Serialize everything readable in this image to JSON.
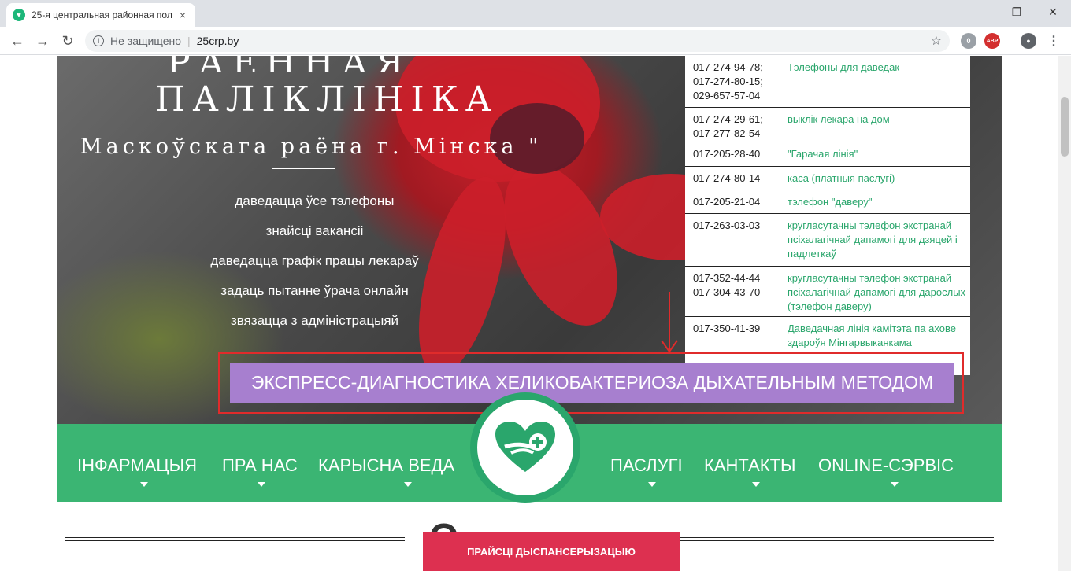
{
  "browser": {
    "tab_title": "25-я центральная районная пол",
    "tab_close": "×",
    "minimize": "—",
    "maximize": "❐",
    "close": "✕",
    "back": "←",
    "forward": "→",
    "reload": "↻",
    "not_secure": "Не защищено",
    "url": "25crp.by",
    "bookmark": "☆",
    "ext_badge": "0",
    "abp": "ABP",
    "menu": "⋮"
  },
  "hero": {
    "title_line1": "РАЁННАЯ",
    "title_line2": "ПАЛІКЛІНІКА",
    "title_line3": "Маскоўскага раёна г. Мінска \"",
    "links": [
      "даведацца ўсе тэлефоны",
      "знайсці вакансіі",
      "даведацца графік працы лекараў",
      "задаць пытанне ўрача онлайн",
      "звязацца з адміністрацыяй"
    ]
  },
  "phones": [
    {
      "number": "017-274-94-78;\n017-274-80-15;\n029-657-57-04",
      "desc": "Тэлефоны для даведак"
    },
    {
      "number": "017-274-29-61;\n017-277-82-54",
      "desc": "выклік лекара на дом"
    },
    {
      "number": "017-205-28-40",
      "desc": "\"Гарачая лінія\""
    },
    {
      "number": "017-274-80-14",
      "desc": "каса (платныя паслугі)"
    },
    {
      "number": "017-205-21-04",
      "desc": "тэлефон \"даверу\""
    },
    {
      "number": "017-263-03-03",
      "desc": "кругласутачны тэлефон экстранай псіхалагічнай дапамогі для дзяцей і падлеткаў"
    },
    {
      "number": "017-352-44-44\n017-304-43-70",
      "desc": "кругласутачны тэлефон экстранай псіхалагічнай дапамогі для дарослых (тэлефон даверу)"
    },
    {
      "number": "017-350-41-39",
      "desc": "Даведачная лінія камітэта па ахове здароўя Мінгарвыканкама"
    }
  ],
  "express_banner": "ЭКСПРЕСС-ДИАГНОСТИКА ХЕЛИКОБАКТЕРИОЗА ДЫХАТЕЛЬНЫМ МЕТОДОМ",
  "nav": {
    "items": [
      "ІНФАРМАЦЫЯ",
      "ПРА НАС",
      "КАРЫСНА ВЕДА",
      "ПАСЛУГІ",
      "КАНТАКТЫ",
      "ONLINE-СЭРВІС"
    ]
  },
  "section_heading_partial": "О",
  "dispensary_button": "ПРАЙСЦІ ДЫСПАНСЕРЫЗАЦЫЮ",
  "colors": {
    "green": "#3bb573",
    "purple": "#a77fcf",
    "red": "#e02b2b",
    "pink": "#dd3050"
  }
}
